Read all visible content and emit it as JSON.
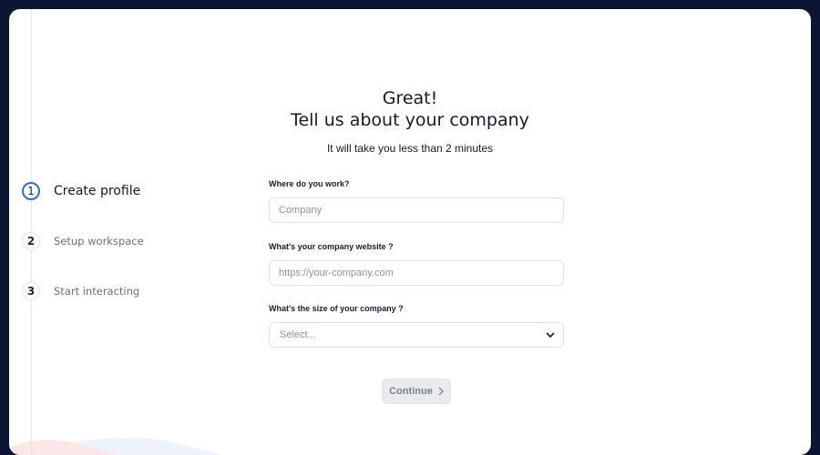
{
  "steps": [
    {
      "number": "1",
      "label": "Create profile"
    },
    {
      "number": "2",
      "label": "Setup workspace"
    },
    {
      "number": "3",
      "label": "Start interacting"
    }
  ],
  "heading": {
    "line1": "Great!",
    "line2": "Tell us about your company"
  },
  "subtitle": "It will take you less than 2 minutes",
  "form": {
    "company_label": "Where do you work?",
    "company_placeholder": "Company",
    "website_label": "What's your company website ?",
    "website_placeholder": "https://your-company.com",
    "size_label": "What's the size of your company ?",
    "size_selected": "Select..."
  },
  "continue_label": "Continue",
  "colors": {
    "accent": "#2b6fd6",
    "background": "#0c1533"
  },
  "icons": {
    "select": "chevron-down-icon",
    "continue": "chevron-right-icon"
  }
}
